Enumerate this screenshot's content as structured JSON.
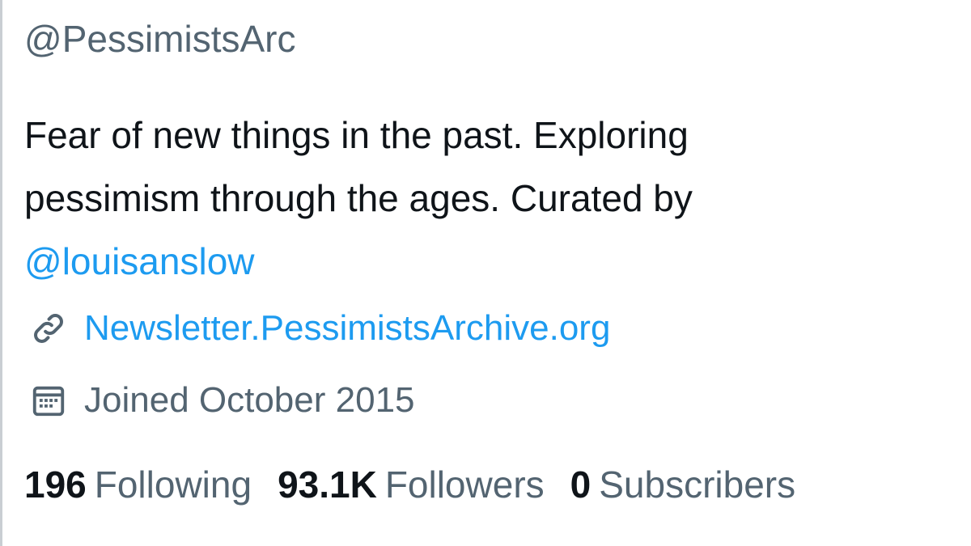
{
  "profile": {
    "handle": "@PessimistsArc",
    "bio": {
      "line1": "Fear of new things in the past. Exploring",
      "line2": "pessimism through the ages. Curated by",
      "mention": "@louisanslow"
    },
    "website": "Newsletter.PessimistsArchive.org",
    "joined": "Joined October 2015",
    "stats": {
      "following_count": "196",
      "following_label": "Following",
      "followers_count": "93.1K",
      "followers_label": "Followers",
      "subscribers_count": "0",
      "subscribers_label": "Subscribers"
    }
  },
  "icons": {
    "link": "link-icon",
    "calendar": "calendar-icon"
  },
  "colors": {
    "link_blue": "#1d9bf0",
    "secondary_text": "#536471",
    "primary_text": "#0f1419"
  }
}
